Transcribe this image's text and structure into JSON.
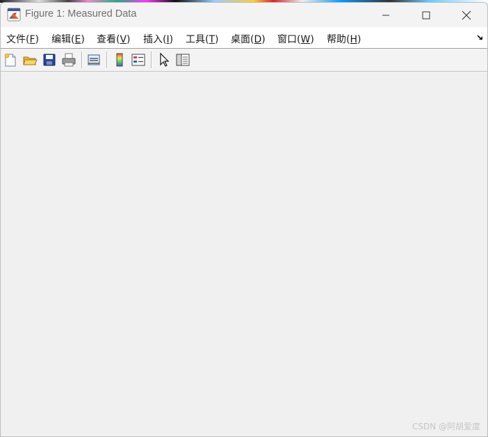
{
  "window": {
    "title": "Figure 1: Measured Data"
  },
  "menubar": {
    "items": [
      {
        "label": "文件(",
        "key": "F",
        "suffix": ")"
      },
      {
        "label": "编辑(",
        "key": "E",
        "suffix": ")"
      },
      {
        "label": "查看(",
        "key": "V",
        "suffix": ")"
      },
      {
        "label": "插入(",
        "key": "I",
        "suffix": ")"
      },
      {
        "label": "工具(",
        "key": "T",
        "suffix": ")"
      },
      {
        "label": "桌面(",
        "key": "D",
        "suffix": ")"
      },
      {
        "label": "窗口(",
        "key": "W",
        "suffix": ")"
      },
      {
        "label": "帮助(",
        "key": "H",
        "suffix": ")"
      }
    ]
  },
  "toolbar": {
    "tools": [
      {
        "icon": "new-figure-icon"
      },
      {
        "icon": "open-file-icon"
      },
      {
        "icon": "save-icon"
      },
      {
        "icon": "print-icon"
      },
      {
        "icon": "link-plot-icon"
      },
      {
        "icon": "insert-colorbar-icon"
      },
      {
        "icon": "insert-legend-icon"
      },
      {
        "icon": "edit-plot-pointer-icon"
      },
      {
        "icon": "property-inspector-icon"
      }
    ]
  },
  "watermark": "CSDN @阿胡爱度",
  "colors": {
    "background": "#f0f0f0",
    "menubar": "#ffffff",
    "title_text": "#6f6f6f",
    "matlab_orange": "#e2672a",
    "save_blue": "#23459b"
  }
}
